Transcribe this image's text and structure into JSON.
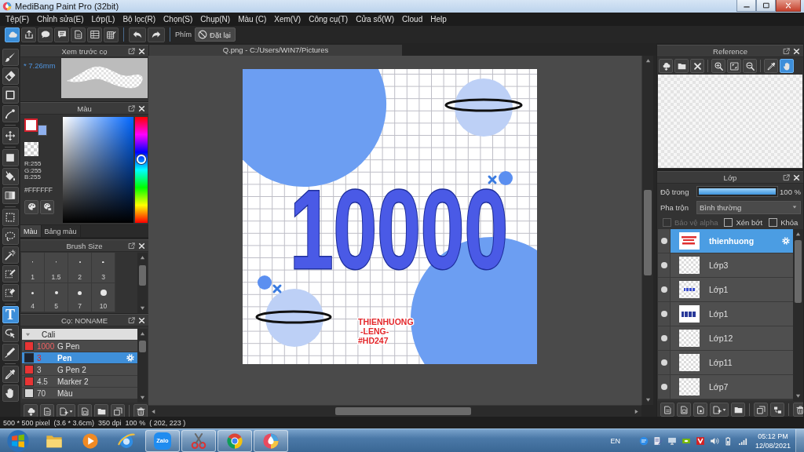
{
  "window": {
    "title": "MediBang Paint Pro (32bit)"
  },
  "menu": [
    "Tệp(F)",
    "Chỉnh sửa(E)",
    "Lớp(L)",
    "Bộ lọc(R)",
    "Chọn(S)",
    "Chụp(N)",
    "Màu (C)",
    "Xem(V)",
    "Công cụ(T)",
    "Cửa sổ(W)",
    "Cloud",
    "Help"
  ],
  "toolbar": {
    "buttons": [
      {
        "kind": "cloud",
        "on": true
      },
      {
        "kind": "share",
        "on": false
      },
      {
        "kind": "bubble",
        "on": false
      },
      {
        "kind": "comment",
        "on": false
      },
      {
        "kind": "page",
        "on": false
      },
      {
        "kind": "table",
        "on": false
      },
      {
        "kind": "gridpen",
        "on": false
      }
    ],
    "shortcut_label": "Phím",
    "reset_button": "Đặt lại"
  },
  "tools": [
    [
      {
        "kind": "brush",
        "selected": false
      },
      {
        "kind": "eraser",
        "selected": false
      },
      {
        "kind": "shape",
        "selected": false
      },
      {
        "kind": "curve",
        "selected": false
      }
    ],
    [
      {
        "kind": "move",
        "selected": false
      }
    ],
    [
      {
        "kind": "fill",
        "selected": false
      },
      {
        "kind": "bucket",
        "selected": false
      },
      {
        "kind": "gradient",
        "selected": false
      }
    ],
    [
      {
        "kind": "select",
        "selected": false
      },
      {
        "kind": "lasso",
        "selected": false
      },
      {
        "kind": "wand",
        "selected": false
      },
      {
        "kind": "selpen",
        "selected": false
      },
      {
        "kind": "seleraser",
        "selected": false
      }
    ],
    [
      {
        "kind": "text",
        "glyph": "T",
        "selected": true
      },
      {
        "kind": "pointer",
        "selected": false
      },
      {
        "kind": "pen",
        "selected": false
      }
    ],
    [
      {
        "kind": "dropper",
        "selected": false
      },
      {
        "kind": "hand",
        "selected": false
      }
    ]
  ],
  "brush_preview": {
    "title": "Xem trước cọ",
    "size": "* 7.26mm"
  },
  "color_panel": {
    "title": "Màu",
    "colors": [
      {
        "color": "#ffffff",
        "selected": true
      },
      {
        "color": "#8fb0ee",
        "selected": false
      }
    ],
    "readout": [
      "R:255",
      "G:255",
      "B:255"
    ],
    "hex": "#FFFFFF",
    "hue_slider": {
      "level": 0.6
    },
    "tabs": [
      {
        "label": "Màu",
        "selected": true
      },
      {
        "label": "Bảng màu",
        "selected": false
      }
    ]
  },
  "brush_size": {
    "title": "Brush Size",
    "sizes": [
      {
        "label": "1",
        "selected": false
      },
      {
        "label": "1.5",
        "selected": false
      },
      {
        "label": "2",
        "selected": false
      },
      {
        "label": "3",
        "selected": false
      },
      {
        "label": "4",
        "selected": false
      },
      {
        "label": "5",
        "selected": false
      },
      {
        "label": "7",
        "selected": false
      },
      {
        "label": "10",
        "selected": false
      }
    ]
  },
  "brushes": {
    "title": "Cọ: NONAME",
    "groups": [
      {
        "name": "Cali",
        "expanded": true,
        "children": [
          {
            "size": "1000",
            "name": "G Pen",
            "color": "#e83434",
            "size_flagged": true,
            "selected": false
          },
          {
            "size": "3",
            "name": "Pen",
            "color": "#1e2430",
            "size_flagged": true,
            "selected": true
          },
          {
            "size": "3",
            "name": "G Pen 2",
            "color": "#e83434",
            "size_flagged": false,
            "selected": false
          },
          {
            "size": "4.5",
            "name": "Marker 2",
            "color": "#e83434",
            "size_flagged": false,
            "selected": false
          },
          {
            "size": "70",
            "name": "Màu",
            "color": "#d6d6d6",
            "size_flagged": false,
            "selected": false
          }
        ]
      }
    ]
  },
  "document": {
    "tab": "Q.png - C:/Users/WIN7/Pictures",
    "artwork": {
      "lettering": "10000",
      "signature": [
        "THIENHUONG",
        "-LENG-",
        "#HD247"
      ]
    }
  },
  "reference": {
    "title": "Reference",
    "tools": [
      [
        {
          "kind": "clouddown",
          "selected": false
        },
        {
          "kind": "folder",
          "selected": false
        },
        {
          "kind": "close",
          "selected": false
        }
      ],
      [
        {
          "kind": "zoomin",
          "selected": false
        },
        {
          "kind": "fit",
          "selected": false
        },
        {
          "kind": "zoomout",
          "selected": false
        }
      ],
      [
        {
          "kind": "dropper",
          "selected": false
        },
        {
          "kind": "hand",
          "selected": true
        }
      ]
    ]
  },
  "layers": {
    "title": "Lớp",
    "opacity": {
      "label": "Độ trong",
      "level": 1,
      "reading": "100 %"
    },
    "blend": {
      "label": "Pha trộn",
      "value": "Bình thường"
    },
    "options": [
      {
        "label": "Bảo vệ alpha",
        "checked": false,
        "disabled": true
      },
      {
        "label": "Xén bớt",
        "checked": false,
        "disabled": false
      },
      {
        "label": "Khóa",
        "checked": false,
        "disabled": false
      }
    ],
    "items": [
      {
        "name": "thienhuong",
        "kind": "signature",
        "visible": true,
        "selected": true
      },
      {
        "name": "Lớp3",
        "kind": "blank",
        "visible": true,
        "selected": false
      },
      {
        "name": "Lớp1",
        "kind": "smallnumber",
        "visible": true,
        "selected": false
      },
      {
        "name": "Lớp1",
        "kind": "number",
        "visible": true,
        "selected": false
      },
      {
        "name": "Lớp12",
        "kind": "blank",
        "visible": true,
        "selected": false
      },
      {
        "name": "Lớp11",
        "kind": "blank",
        "visible": true,
        "selected": false
      },
      {
        "name": "Lớp7",
        "kind": "blank",
        "visible": true,
        "selected": false
      }
    ]
  },
  "status_bar": [
    "500 * 500 pixel",
    "(3.6 * 3.6cm)",
    "350 dpi",
    "100 %",
    "( 202, 223 )"
  ],
  "taskbar": {
    "apps": [
      {
        "kind": "folder",
        "running": false
      },
      {
        "kind": "player",
        "running": false
      },
      {
        "kind": "globe",
        "running": false
      },
      {
        "kind": "chat",
        "label": "Zalo",
        "running": true
      },
      {
        "kind": "scissors",
        "running": true
      },
      {
        "kind": "ball",
        "running": true
      },
      {
        "kind": "drop",
        "running": true
      }
    ],
    "language": "EN",
    "time": "05:12 PM",
    "date": "12/08/2021"
  }
}
